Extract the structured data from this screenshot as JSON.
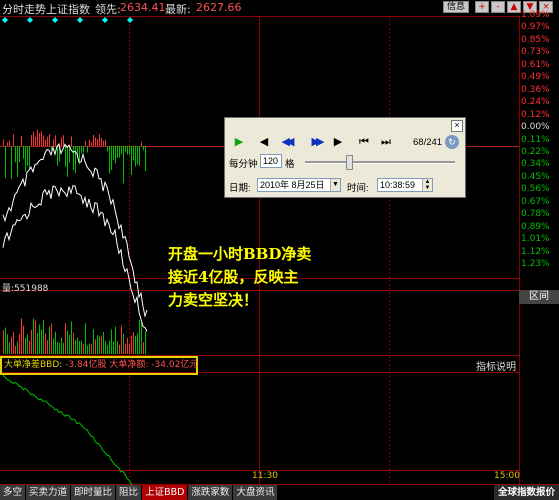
{
  "header": {
    "panel_title": "分时走势",
    "index_name": "上证指数",
    "lead_label": "领先:",
    "lead_value": "2634.41",
    "latest_label": "最新:",
    "latest_value": "2627.66",
    "info_button": "信息",
    "buttons": [
      "+",
      "-",
      "▲",
      "▼",
      "×"
    ]
  },
  "percent_axis": [
    "1.09%",
    "0.97%",
    "0.85%",
    "0.73%",
    "0.61%",
    "0.49%",
    "0.36%",
    "0.24%",
    "0.12%",
    "0.00%",
    "0.11%",
    "0.22%",
    "0.34%",
    "0.45%",
    "0.56%",
    "0.67%",
    "0.78%",
    "0.89%",
    "1.01%",
    "1.12%",
    "1.23%"
  ],
  "volume": {
    "label": "量:",
    "value": "551988"
  },
  "right_button": "区间",
  "indicator": {
    "label1": "大单净差BBD:",
    "value1": "-3.84亿股",
    "label2": "大单净额:",
    "value2": "-34.02亿元",
    "help": "指标说明"
  },
  "time_labels": [
    "11:30",
    "15:00"
  ],
  "annotation": [
    "开盘一小时BBD净卖",
    "接近4亿股，反映主",
    "力卖空坚决！"
  ],
  "tabs": [
    "多空",
    "买卖力道",
    "即时量比",
    "阻比",
    "上证BBD",
    "涨跌家数",
    "大盘资讯"
  ],
  "active_tab": "上证BBD",
  "bottom_right": "全球指数报价",
  "playback": {
    "counter": "68/241",
    "per_minute_label": "每分钟",
    "per_minute_value": "120",
    "per_minute_unit": "格",
    "date_label": "日期:",
    "date_value": "2010年 8月25日",
    "time_label": "时间:",
    "time_value": "10:38:59"
  },
  "colors": {
    "grid": "#8b0000",
    "up": "#ff3030",
    "down": "#00c000",
    "price_line": "#ffffff",
    "highlight": "#e6d200",
    "annotation": "#ffff00"
  }
}
